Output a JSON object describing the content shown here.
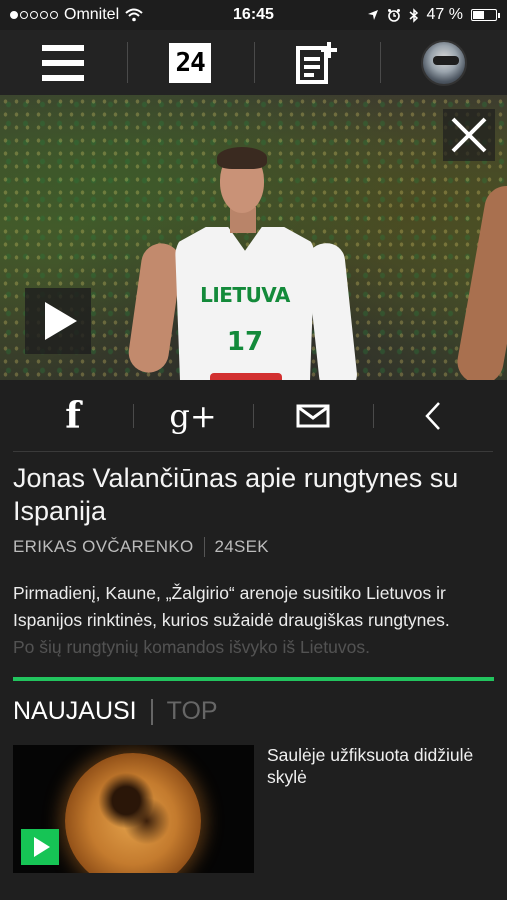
{
  "status_bar": {
    "carrier": "Omnitel",
    "time": "16:45",
    "battery": "47 %",
    "battery_level": 0.47,
    "icons": [
      "wifi-icon",
      "location-icon",
      "alarm-icon",
      "bluetooth-icon",
      "battery-icon"
    ]
  },
  "nav": {
    "logo": "24",
    "icons": [
      "menu-icon",
      "logo-24-icon",
      "add-article-icon",
      "avatar"
    ]
  },
  "video": {
    "jersey_text": "LIETUVA",
    "jersey_number": "17",
    "icons": [
      "play-icon",
      "close-icon"
    ]
  },
  "share": {
    "facebook": "f",
    "google_plus": "g+",
    "icons": [
      "facebook-icon",
      "google-plus-icon",
      "mail-icon",
      "back-chevron-icon"
    ]
  },
  "article": {
    "title": "Jonas Valančiūnas apie rungtynes su Ispanija",
    "author": "ERIKAS OVČARENKO",
    "source": "24SEK",
    "excerpt_line1": "Pirmadienį, Kaune, „Žalgirio“ arenoje susitiko Lietuvos ir",
    "excerpt_line2": "Ispanijos rinktinės, kurios sužaidė draugiškas rungtynes.",
    "excerpt_line3": "Po šių rungtynių komandos išvyko iš Lietuvos."
  },
  "tabs": {
    "active": "NAUJAUSI",
    "inactive": "TOP"
  },
  "news": [
    {
      "title": "Saulėje užfiksuota didžiulė skylė"
    }
  ],
  "colors": {
    "accent": "#22c45e",
    "background": "#1f1f1f"
  }
}
